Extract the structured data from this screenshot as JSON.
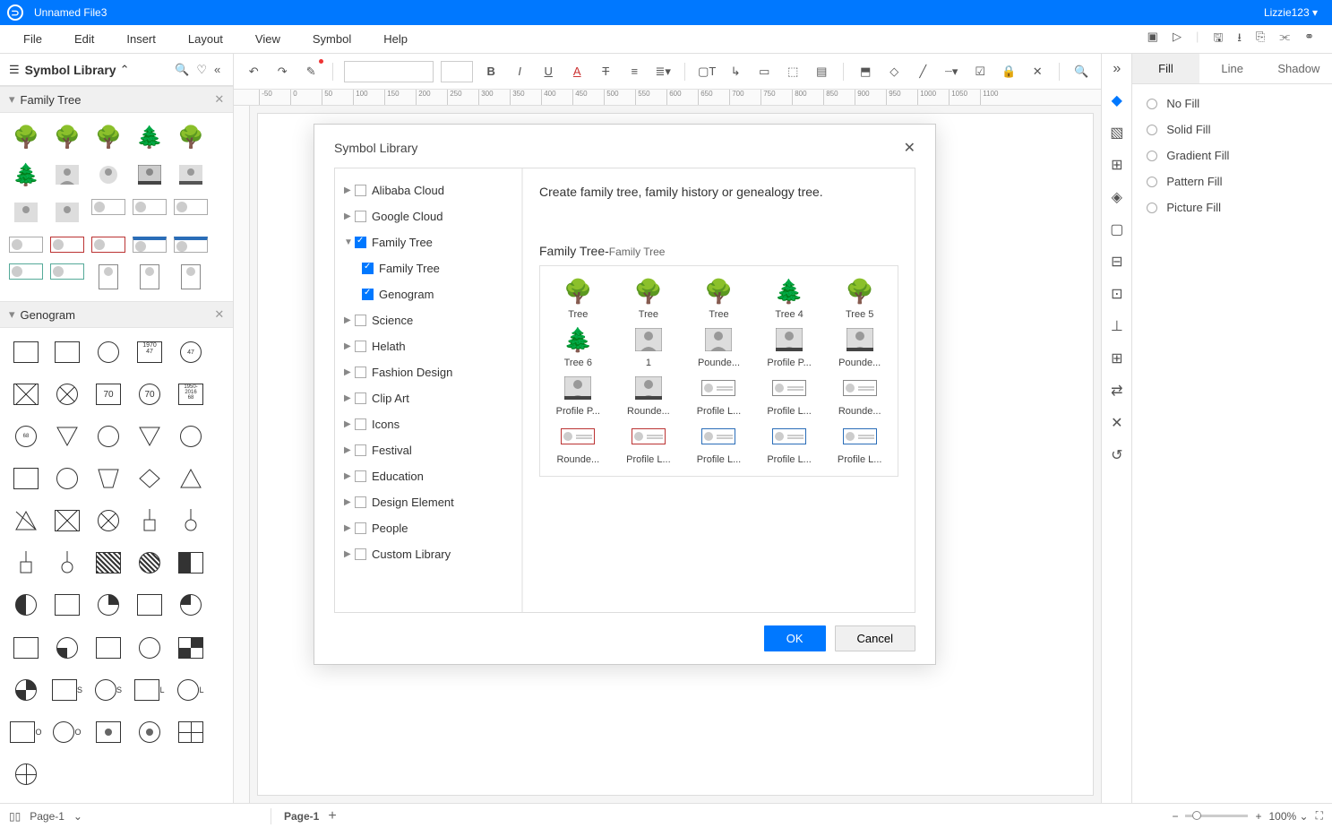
{
  "titlebar": {
    "filename": "Unnamed File3",
    "user": "Lizzie123"
  },
  "menu": [
    "File",
    "Edit",
    "Insert",
    "Layout",
    "View",
    "Symbol",
    "Help"
  ],
  "leftpanel": {
    "title": "Symbol Library",
    "sections": [
      {
        "name": "Family Tree"
      },
      {
        "name": "Genogram"
      }
    ]
  },
  "dialog": {
    "title": "Symbol Library",
    "tree": [
      {
        "label": "Alibaba Cloud",
        "checked": false,
        "expanded": false
      },
      {
        "label": "Google Cloud",
        "checked": false,
        "expanded": false
      },
      {
        "label": "Family Tree",
        "checked": true,
        "expanded": true,
        "children": [
          {
            "label": "Family Tree",
            "checked": true
          },
          {
            "label": "Genogram",
            "checked": true
          }
        ]
      },
      {
        "label": "Science",
        "checked": false
      },
      {
        "label": "Helath",
        "checked": false
      },
      {
        "label": "Fashion Design",
        "checked": false
      },
      {
        "label": "Clip Art",
        "checked": false
      },
      {
        "label": "Icons",
        "checked": false
      },
      {
        "label": "Festival",
        "checked": false
      },
      {
        "label": "Education",
        "checked": false
      },
      {
        "label": "Design Element",
        "checked": false
      },
      {
        "label": "People",
        "checked": false
      },
      {
        "label": "Custom Library",
        "checked": false
      }
    ],
    "desc": "Create family tree, family history or genealogy tree.",
    "subtitle": "Family Tree-",
    "subtitle_small": "Family Tree",
    "symbols": [
      "Tree",
      "Tree",
      "Tree",
      "Tree 4",
      "Tree 5",
      "Tree 6",
      "1",
      "Pounde...",
      "Profile P...",
      "Pounde...",
      "Profile P...",
      "Rounde...",
      "Profile L...",
      "Profile L...",
      "Rounde...",
      "Rounde...",
      "Profile L...",
      "Profile L...",
      "Profile L...",
      "Profile L..."
    ],
    "ok": "OK",
    "cancel": "Cancel"
  },
  "rightpanel": {
    "tabs": [
      "Fill",
      "Line",
      "Shadow"
    ],
    "active": 0,
    "fill_options": [
      "No Fill",
      "Solid Fill",
      "Gradient Fill",
      "Pattern Fill",
      "Picture Fill"
    ]
  },
  "statusbar": {
    "page_dd": "Page-1",
    "page_tab": "Page-1",
    "zoom": "100%"
  },
  "ruler_ticks": [
    -50,
    0,
    50,
    100,
    150,
    200,
    250,
    300,
    350,
    400,
    450,
    500,
    550,
    600,
    650,
    700,
    750,
    800,
    850,
    900,
    950,
    1000,
    1050,
    1100
  ]
}
